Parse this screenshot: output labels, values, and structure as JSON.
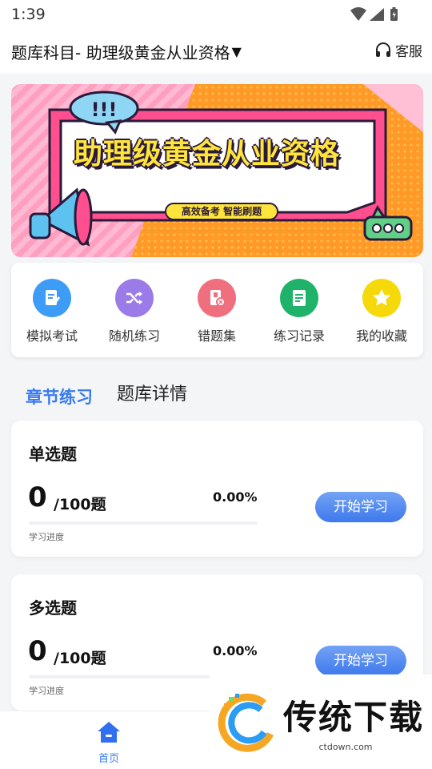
{
  "status": {
    "time": "1:39"
  },
  "header": {
    "subject": "题库科目- 助理级黄金从业资格",
    "caret": "▼",
    "support": "客服"
  },
  "banner": {
    "title": "助理级黄金从业资格",
    "tagline": "高效备考 智能刷题"
  },
  "quick_actions": [
    {
      "label": "模拟考试",
      "color": "#3d9cf5",
      "icon": "exam-icon"
    },
    {
      "label": "随机练习",
      "color": "#9b7be8",
      "icon": "shuffle-icon"
    },
    {
      "label": "错题集",
      "color": "#f06f7f",
      "icon": "wrong-questions-icon"
    },
    {
      "label": "练习记录",
      "color": "#1fb36a",
      "icon": "record-icon"
    },
    {
      "label": "我的收藏",
      "color": "#f5d90a",
      "icon": "star-icon"
    }
  ],
  "tabs": {
    "active": "章节练习",
    "other": "题库详情"
  },
  "sections": [
    {
      "title": "单选题",
      "done": "0",
      "total": "/100题",
      "percent": "0.00%",
      "progress_label": "学习进度",
      "button": "开始学习",
      "progress": 0
    },
    {
      "title": "多选题",
      "done": "0",
      "total": "/100题",
      "percent": "0.00%",
      "progress_label": "学习进度",
      "button": "开始学习",
      "progress": 0
    }
  ],
  "nav": {
    "home": "首页"
  },
  "watermark": {
    "text": "传统下载",
    "url": "ctdown.com"
  },
  "colors": {
    "accent": "#3a7bf0",
    "button": "#4a82f0"
  }
}
